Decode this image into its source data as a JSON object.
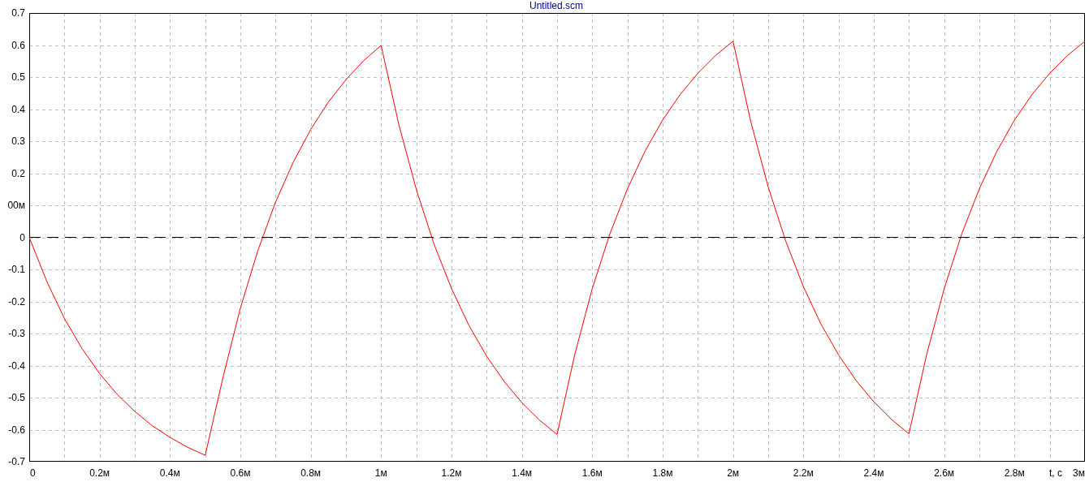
{
  "plot": {
    "chart_data": {
      "type": "line",
      "title": "Untitled.scm",
      "xlabel": "t, c",
      "x": [
        0,
        0.05,
        0.1,
        0.15,
        0.2,
        0.25,
        0.3,
        0.35,
        0.4,
        0.45,
        0.5,
        0.55,
        0.6,
        0.65,
        0.7,
        0.75,
        0.8,
        0.85,
        0.9,
        0.95,
        1,
        1.05,
        1.1,
        1.15,
        1.2,
        1.25,
        1.3,
        1.35,
        1.4,
        1.45,
        1.5,
        1.55,
        1.6,
        1.65,
        1.7,
        1.75,
        1.8,
        1.85,
        1.9,
        1.95,
        2,
        2.05,
        2.1,
        2.15,
        2.2,
        2.25,
        2.3,
        2.35,
        2.4,
        2.45,
        2.5,
        2.55,
        2.6,
        2.65,
        2.7,
        2.75,
        2.8,
        2.85,
        2.9,
        2.95,
        3
      ],
      "series": [
        {
          "color": "#ff0000",
          "values": [
            0,
            -0.138,
            -0.253,
            -0.347,
            -0.425,
            -0.49,
            -0.543,
            -0.588,
            -0.624,
            -0.655,
            -0.68,
            -0.44,
            -0.221,
            -0.04,
            0.11,
            0.234,
            0.337,
            0.422,
            0.492,
            0.551,
            0.599,
            0.353,
            0.149,
            -0.02,
            -0.16,
            -0.276,
            -0.371,
            -0.45,
            -0.516,
            -0.57,
            -0.615,
            -0.366,
            -0.16,
            0.011,
            0.152,
            0.269,
            0.366,
            0.446,
            0.512,
            0.567,
            0.612,
            0.363,
            0.157,
            -0.013,
            -0.154,
            -0.271,
            -0.367,
            -0.447,
            -0.513,
            -0.568,
            -0.613,
            -0.366,
            -0.16,
            0.011,
            0.152,
            0.269,
            0.366,
            0.446,
            0.512,
            0.567,
            0.612
          ]
        },
        {
          "color": "#000000",
          "line_style": "dashed",
          "values": [
            0,
            0,
            0,
            0,
            0,
            0,
            0,
            0,
            0,
            0,
            0,
            0,
            0,
            0,
            0,
            0,
            0,
            0,
            0,
            0,
            0,
            0,
            0,
            0,
            0,
            0,
            0,
            0,
            0,
            0,
            0,
            0,
            0,
            0,
            0,
            0,
            0,
            0,
            0,
            0,
            0,
            0,
            0,
            0,
            0,
            0,
            0,
            0,
            0,
            0,
            0,
            0,
            0,
            0,
            0,
            0,
            0,
            0,
            0,
            0,
            0
          ]
        }
      ],
      "grid": true,
      "xlim": [
        0,
        3
      ],
      "ylim": [
        -0.7,
        0.7
      ],
      "xticks": [
        {
          "value": 0,
          "label": "0"
        },
        {
          "value": 0.2,
          "label": "0.2м"
        },
        {
          "value": 0.4,
          "label": "0.4м"
        },
        {
          "value": 0.6,
          "label": "0.6м"
        },
        {
          "value": 0.8,
          "label": "0.8м"
        },
        {
          "value": 1,
          "label": "1м"
        },
        {
          "value": 1.2,
          "label": "1.2м"
        },
        {
          "value": 1.4,
          "label": "1.4м"
        },
        {
          "value": 1.6,
          "label": "1.6м"
        },
        {
          "value": 1.8,
          "label": "1.8м"
        },
        {
          "value": 2,
          "label": "2м"
        },
        {
          "value": 2.2,
          "label": "2.2м"
        },
        {
          "value": 2.4,
          "label": "2.4м"
        },
        {
          "value": 2.6,
          "label": "2.6м"
        },
        {
          "value": 2.8,
          "label": "2.8м"
        },
        {
          "value": 3,
          "label": "3м"
        }
      ],
      "yticks": [
        {
          "value": 0.7,
          "label": "0.7"
        },
        {
          "value": 0.6,
          "label": "0.6"
        },
        {
          "value": 0.5,
          "label": "0.5"
        },
        {
          "value": 0.4,
          "label": "0.4"
        },
        {
          "value": 0.3,
          "label": "0.3"
        },
        {
          "value": 0.2,
          "label": "0.2"
        },
        {
          "value": 0.1,
          "label": "00м"
        },
        {
          "value": 0,
          "label": "0"
        },
        {
          "value": -0.1,
          "label": "-0.1"
        },
        {
          "value": -0.2,
          "label": "-0.2"
        },
        {
          "value": -0.3,
          "label": "-0.3"
        },
        {
          "value": -0.4,
          "label": "-0.4"
        },
        {
          "value": -0.5,
          "label": "-0.5"
        },
        {
          "value": -0.6,
          "label": "-0.6"
        },
        {
          "value": -0.7,
          "label": "-0.7"
        }
      ]
    }
  }
}
